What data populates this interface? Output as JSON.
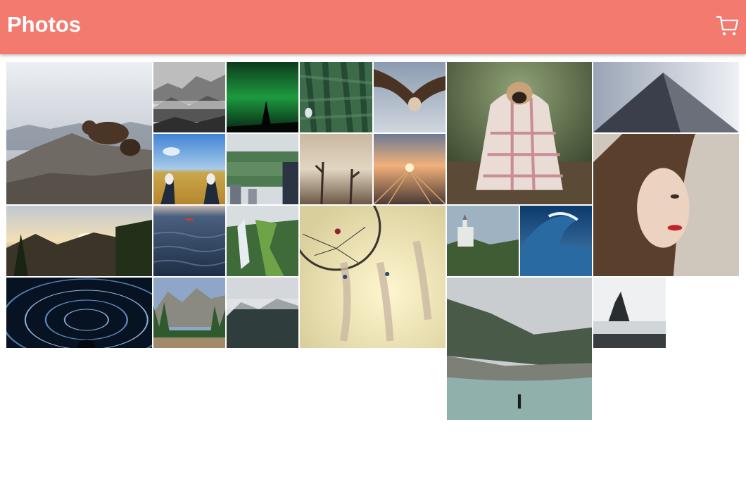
{
  "appbar": {
    "title": "Photos",
    "cart_icon": "shopping-cart-icon",
    "color": "#f27a6e"
  },
  "photos": [
    {
      "name": "photo-bear-on-rocks",
      "subject": "bear"
    },
    {
      "name": "photo-misty-forest-hills",
      "subject": "misty-forest"
    },
    {
      "name": "photo-aurora-night",
      "subject": "aurora"
    },
    {
      "name": "photo-bird-in-pine",
      "subject": "bird-pine"
    },
    {
      "name": "photo-vulture-flying",
      "subject": "vulture"
    },
    {
      "name": "photo-pug-in-blanket",
      "subject": "pug"
    },
    {
      "name": "photo-skyscraper",
      "subject": "skyscraper"
    },
    {
      "name": "photo-feet-in-field",
      "subject": "feet-field"
    },
    {
      "name": "photo-city-park",
      "subject": "city-park"
    },
    {
      "name": "photo-dead-trees",
      "subject": "dead-trees"
    },
    {
      "name": "photo-railway-sunset",
      "subject": "railway-sunset"
    },
    {
      "name": "photo-woman-portrait",
      "subject": "portrait"
    },
    {
      "name": "photo-mountain-sunset",
      "subject": "mountain-sunset"
    },
    {
      "name": "photo-sea-kayak",
      "subject": "sea-kayak"
    },
    {
      "name": "photo-waterfall",
      "subject": "waterfall"
    },
    {
      "name": "photo-dreamcatcher",
      "subject": "dreamcatcher"
    },
    {
      "name": "photo-castle",
      "subject": "castle"
    },
    {
      "name": "photo-ocean-wave",
      "subject": "wave"
    },
    {
      "name": "photo-star-trails",
      "subject": "star-trails"
    },
    {
      "name": "photo-yosemite",
      "subject": "yosemite"
    },
    {
      "name": "photo-foggy-mountain",
      "subject": "foggy-mountain"
    },
    {
      "name": "photo-river-hiker",
      "subject": "river-hiker"
    },
    {
      "name": "photo-sea-stack",
      "subject": "sea-stack"
    }
  ]
}
